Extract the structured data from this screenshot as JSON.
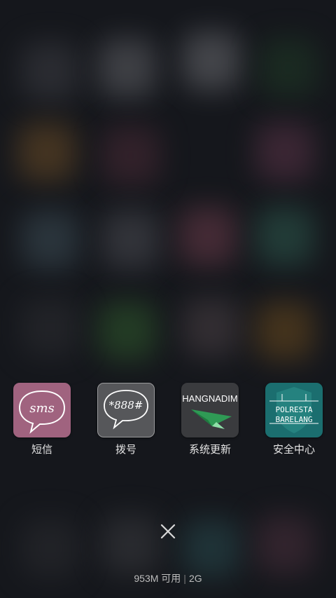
{
  "recents": {
    "apps": [
      {
        "label": "短信",
        "icon": "sms-icon",
        "icon_text": "sms",
        "icon_bg": "#a0637f"
      },
      {
        "label": "拨号",
        "icon": "dialer-icon",
        "icon_text": "*888#",
        "icon_bg": "#56575a"
      },
      {
        "label": "系统更新",
        "icon": "system-update-icon",
        "icon_text": "HANGNADIM",
        "icon_bg": "#3a3b3e"
      },
      {
        "label": "安全中心",
        "icon": "security-center-icon",
        "icon_text": [
          "POLRESTA",
          "BARELANG"
        ],
        "icon_bg": "#1b6e6f"
      }
    ],
    "close_icon": "close-icon"
  },
  "status": {
    "memory_available": "953M 可用",
    "memory_total": "2G"
  }
}
